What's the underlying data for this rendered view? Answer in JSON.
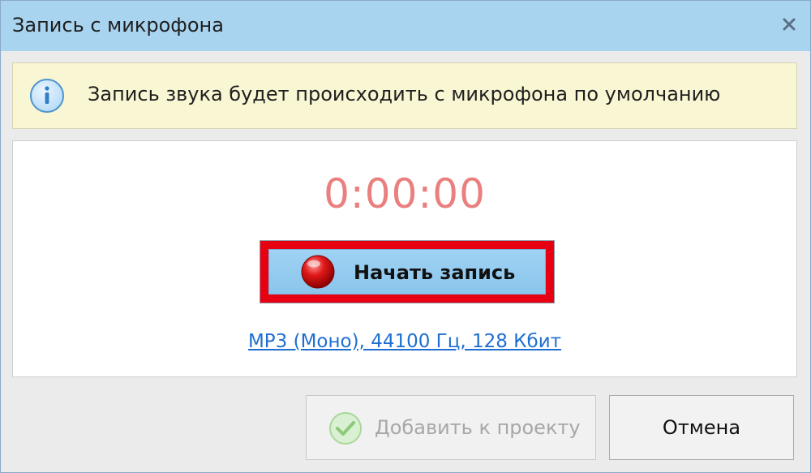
{
  "window": {
    "title": "Запись с микрофона",
    "close_icon": "close-icon"
  },
  "info": {
    "icon": "info-icon",
    "message": "Запись звука будет происходить с микрофона по умолчанию"
  },
  "recorder": {
    "timer": "0:00:00",
    "record_button_label": "Начать запись",
    "record_icon": "record-icon",
    "format_link": "MP3 (Моно), 44100 Гц, 128 Кбит"
  },
  "footer": {
    "add_button_label": "Добавить к проекту",
    "add_button_icon": "check-icon",
    "cancel_button_label": "Отмена"
  },
  "colors": {
    "titlebar": "#a9d4f0",
    "info_background": "#f9f7d3",
    "timer": "#ea7f7f",
    "record_highlight": "#e60012",
    "link": "#1f6fd1"
  }
}
